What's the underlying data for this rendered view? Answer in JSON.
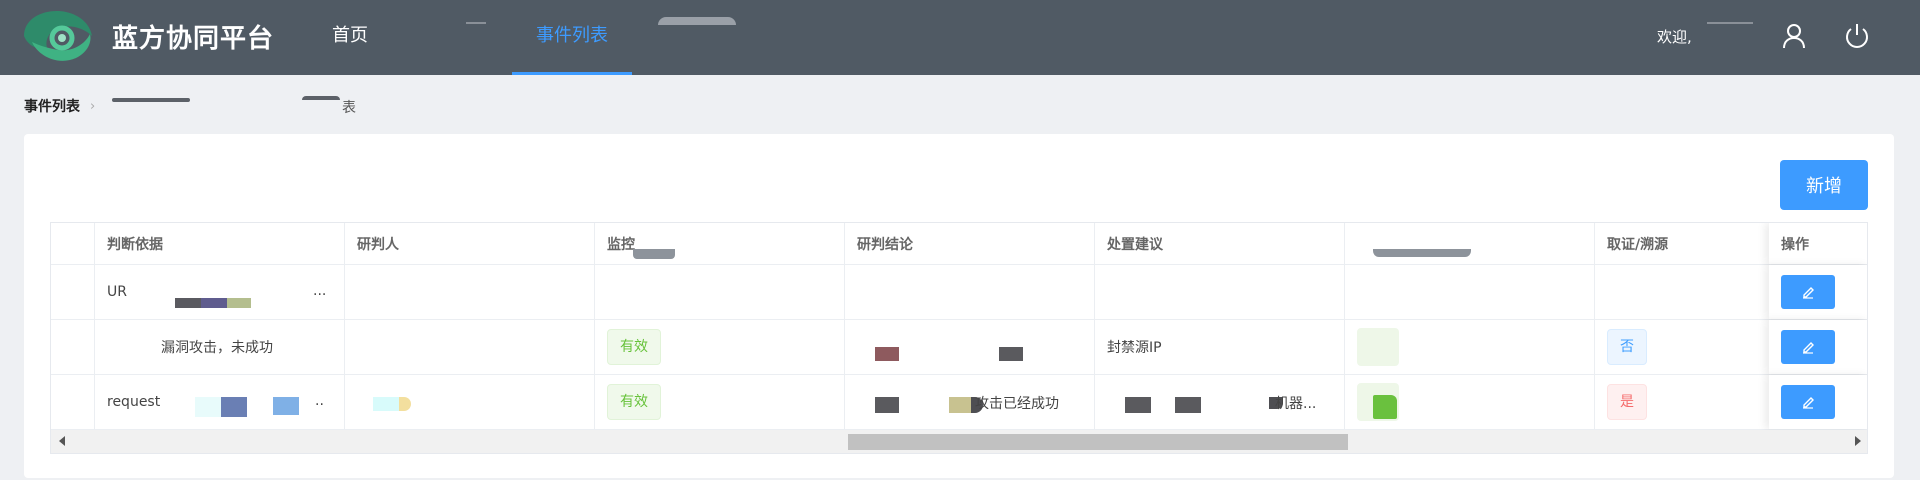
{
  "header": {
    "brand": "蓝方协同平台",
    "nav": [
      {
        "label": "首页"
      },
      {
        "label": "事件列表"
      }
    ],
    "welcome": "欢迎,"
  },
  "breadcrumb": {
    "current": "事件列表",
    "tail": "表"
  },
  "toolbar": {
    "add_label": "新增"
  },
  "table": {
    "columns": [
      "判断依据",
      "研判人",
      "监控",
      "研判结论",
      "处置建议",
      "",
      "取证/溯源",
      "操作"
    ],
    "rows": [
      {
        "basis": "UR",
        "basis_tail": "...",
        "judge": "",
        "monitor": "",
        "conclusion": "",
        "advice": "",
        "col6": "",
        "evidence": ""
      },
      {
        "basis": "漏洞攻击，未成功",
        "judge": "",
        "monitor": "有效",
        "conclusion": "",
        "advice": "封禁源IP",
        "col6": "",
        "evidence": "否"
      },
      {
        "basis": "request",
        "basis_tail": "..",
        "judge": "",
        "monitor": "有效",
        "conclusion": "攻击已经成功",
        "advice_tail": "机器...",
        "col6": "",
        "evidence": "是"
      }
    ]
  },
  "colors": {
    "header_bg": "#505a64",
    "accent": "#3d9bff",
    "success": "#67c23a",
    "danger": "#f56c6c"
  }
}
